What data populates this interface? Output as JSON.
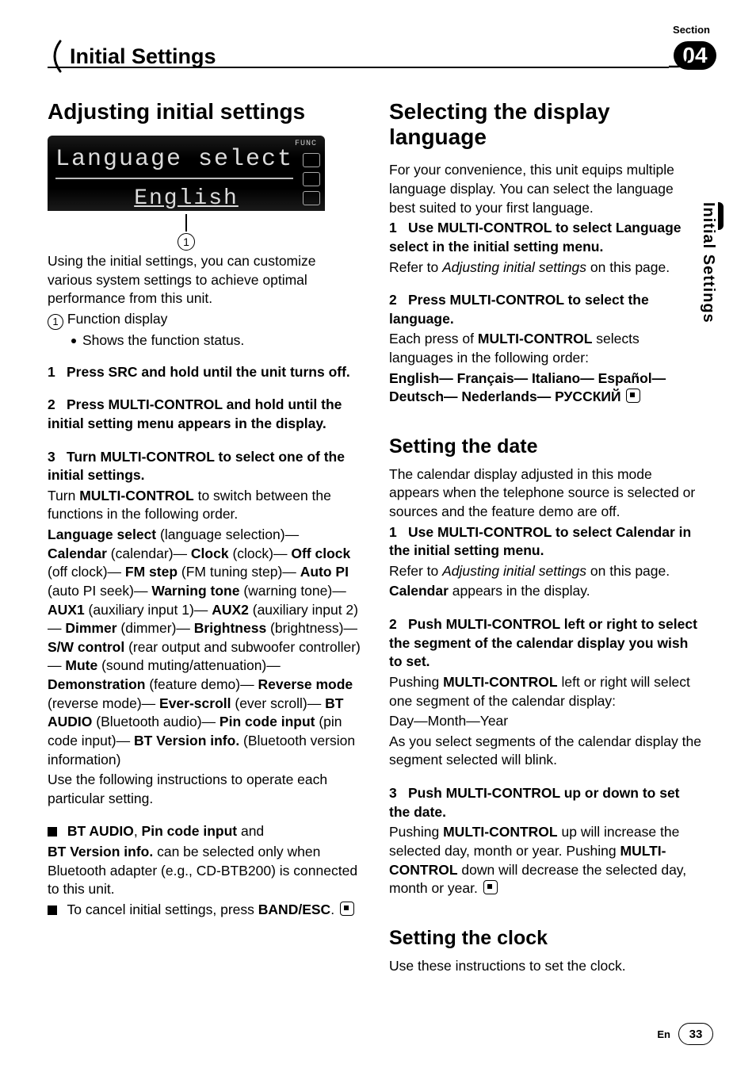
{
  "header": {
    "section_label": "Section",
    "chapter_number": "04",
    "title": "Initial Settings"
  },
  "side_tab": "Initial Settings",
  "footer": {
    "lang": "En",
    "page": "33"
  },
  "left": {
    "h1": "Adjusting initial settings",
    "lcd": {
      "line1": "Language select",
      "line2": "English",
      "func": "FUNC"
    },
    "callout_num": "1",
    "intro": "Using the initial settings, you can customize various system settings to achieve optimal performance from this unit.",
    "fn1_num": "1",
    "fn1_label": "Function display",
    "fn1_sub": "Shows the function status.",
    "step1_num": "1",
    "step1_head": "Press SRC and hold until the unit turns off.",
    "step2_num": "2",
    "step2_head": "Press MULTI-CONTROL and hold until the initial setting menu appears in the display.",
    "step3_num": "3",
    "step3_head": "Turn MULTI-CONTROL to select one of the initial settings.",
    "step3_line1_a": "Turn ",
    "step3_line1_b": "MULTI-CONTROL",
    "step3_line1_c": " to switch between the functions in the following order.",
    "seq": {
      "language_select_b": "Language select",
      "language_select_t": " (language selection)—",
      "calendar_b": "Calendar",
      "calendar_t": " (calendar)—",
      "clock_b": "Clock",
      "clock_t": " (clock)—",
      "offclock_b": "Off clock",
      "offclock_t": " (off clock)—",
      "fmstep_b": "FM step",
      "fmstep_t": " (FM tuning step)—",
      "autopi_b": "Auto PI",
      "autopi_t": " (auto PI seek)—",
      "warning_b": "Warning tone",
      "warning_t": " (warning tone)—",
      "aux1_b": "AUX1",
      "aux1_t": " (auxiliary input 1)—",
      "aux2_b": "AUX2",
      "aux2_t": " (auxiliary input 2)—",
      "dimmer_b": "Dimmer",
      "dimmer_t": " (dimmer)—",
      "bright_b": "Brightness",
      "bright_t": " (brightness)—",
      "sw_b": "S/W control",
      "sw_t": " (rear output and subwoofer controller)—",
      "mute_b": "Mute",
      "mute_t": " (sound muting/attenuation)—",
      "demo_b": "Demonstration",
      "demo_t": " (feature demo)—",
      "rev_b": "Reverse mode",
      "rev_t": " (reverse mode)—",
      "ever_b": "Ever-scroll",
      "ever_t": " (ever scroll)—",
      "bta_b": "BT AUDIO",
      "bta_t": " (Bluetooth audio)—",
      "pin_b": "Pin code input",
      "pin_t": " (pin code input)—",
      "btv_b": "BT Version info.",
      "btv_t": " (Bluetooth version information)"
    },
    "step3_after": "Use the following instructions to operate each particular setting.",
    "note1_b1": "BT AUDIO",
    "note1_m": ", ",
    "note1_b2": "Pin code input",
    "note1_t": " and",
    "note1_line2_b": "BT Version info.",
    "note1_line2_t": " can be selected only when Bluetooth adapter (e.g., CD-BTB200) is connected to this unit.",
    "note2_a": "To cancel initial settings, press ",
    "note2_b": "BAND/ESC",
    "note2_c": "."
  },
  "right": {
    "h1a": "Selecting the display language",
    "lang_intro": "For your convenience, this unit equips multiple language display. You can select the language best suited to your first language.",
    "lang_s1_num": "1",
    "lang_s1_head": "Use MULTI-CONTROL to select Language select in the initial setting menu.",
    "lang_s1_b1": "Refer to ",
    "lang_s1_i": "Adjusting initial settings",
    "lang_s1_b2": " on this page.",
    "lang_s2_num": "2",
    "lang_s2_head": "Press MULTI-CONTROL to select the language.",
    "lang_s2_a": "Each press of ",
    "lang_s2_b": "MULTI-CONTROL",
    "lang_s2_c": " selects languages in the following order:",
    "lang_order": {
      "en": "English",
      "fr": "Français",
      "it": "Italiano",
      "es": "Español",
      "de": "Deutsch",
      "nl": "Nederlands",
      "ru": "РУССКИЙ",
      "sep": "—"
    },
    "h2_date": "Setting the date",
    "date_intro": "The calendar display adjusted in this mode appears when the telephone source is selected or sources and the feature demo are off.",
    "date_s1_num": "1",
    "date_s1_head": "Use MULTI-CONTROL to select Calendar in the initial setting menu.",
    "date_s1_a": "Refer to ",
    "date_s1_i": "Adjusting initial settings",
    "date_s1_b": " on this page.",
    "date_s1_c": "Calendar",
    "date_s1_d": " appears in the display.",
    "date_s2_num": "2",
    "date_s2_head": "Push MULTI-CONTROL left or right to select the segment of the calendar display you wish to set.",
    "date_s2_a": "Pushing ",
    "date_s2_b": "MULTI-CONTROL",
    "date_s2_c": " left or right will select one segment of the calendar display:",
    "date_s2_dmy": "Day—Month—Year",
    "date_s2_e": "As you select segments of the calendar display the segment selected will blink.",
    "date_s3_num": "3",
    "date_s3_head": "Push MULTI-CONTROL up or down to set the date.",
    "date_s3_a": "Pushing ",
    "date_s3_b": "MULTI-CONTROL",
    "date_s3_c": " up will increase the selected day, month or year. Pushing ",
    "date_s3_d": "MULTI-CONTROL",
    "date_s3_e": " down will decrease the selected day, month or year.",
    "h2_clock": "Setting the clock",
    "clock_intro": "Use these instructions to set the clock."
  }
}
